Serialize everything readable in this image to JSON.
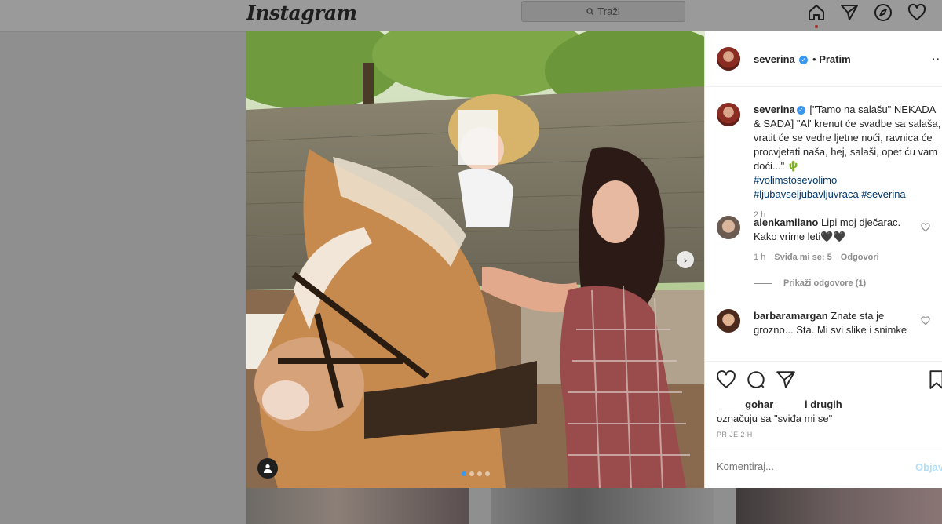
{
  "topbar": {
    "logo": "Instagram",
    "search_placeholder": "Traži",
    "icons": [
      "home-icon",
      "direct-icon",
      "explore-icon",
      "activity-heart-icon"
    ]
  },
  "post": {
    "author": "severina",
    "follow_status": "Pratim",
    "separator": "•",
    "caption": "[\"Tamo na salašu\" NEKADA & SADA] \"Al' krenut će svadbe sa salaša, vratit će se vedre ljetne noći, ravnica će procvjetati naša, hej, salaši, opet ću vam doći...\" 🌵",
    "hashtags": [
      "#volimstosevolimo",
      "#ljubavseljubavljuvraca #severina"
    ],
    "caption_time": "2 h",
    "comments": [
      {
        "user": "alenkamilano",
        "text": "Lipi moj dječarac. Kako vrime leti🖤🖤",
        "time": "1 h",
        "likes": "Sviđa mi se: 5",
        "reply": "Odgovori",
        "view_replies": "Prikaži odgovore (1)"
      },
      {
        "user": "barbaramargan",
        "text": "Znate sta je grozno... Sta. Mi svi slike i snimke"
      }
    ],
    "likes_user": "_____gohar_____",
    "likes_rest": " i drugih",
    "likes_line2": "označuju sa \"sviđa mi se\"",
    "posted_ago": "PRIJE 2 H",
    "comment_placeholder": "Komentiraj...",
    "post_button": "Objav",
    "carousel": {
      "count": 4,
      "active": 1
    }
  },
  "colors": {
    "accent": "#3897f0",
    "hashtag": "#00376b",
    "muted": "#8e8e8e",
    "overlay": "#8f8f8f"
  }
}
